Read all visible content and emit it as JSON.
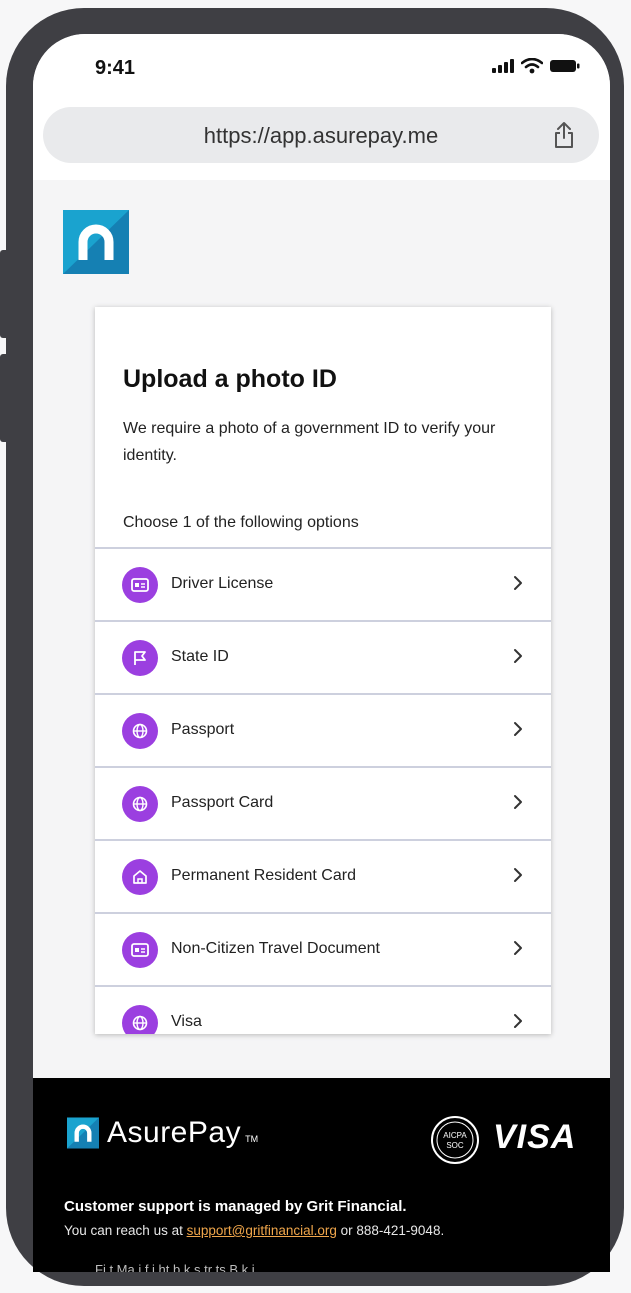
{
  "status_bar": {
    "time": "9:41"
  },
  "browser": {
    "url": "https://app.asurepay.me"
  },
  "card": {
    "title": "Upload a photo ID",
    "description": "We require a photo of a government ID to verify your identity.",
    "subtitle": "Choose 1 of the following options",
    "options": [
      {
        "label": "Driver License",
        "icon": "id-card-icon"
      },
      {
        "label": "State ID",
        "icon": "flag-icon"
      },
      {
        "label": "Passport",
        "icon": "globe-icon"
      },
      {
        "label": "Passport Card",
        "icon": "globe-icon"
      },
      {
        "label": "Permanent Resident Card",
        "icon": "home-icon"
      },
      {
        "label": "Non-Citizen Travel Document",
        "icon": "id-card-icon"
      },
      {
        "label": "Visa",
        "icon": "globe-icon"
      }
    ]
  },
  "footer": {
    "brand": "AsurePay",
    "brand_tm": "TM",
    "badge_top": "AICPA",
    "badge_bottom": "SOC",
    "visa": "VISA",
    "support_title": "Customer support is managed by Grit Financial.",
    "support_prefix": "You can reach us at ",
    "support_email": "support@gritfinancial.org",
    "support_suffix": " or 888-421-9048.",
    "disclaimer": "Fi     t   Ma i        f    i  ht    b   k  s       tr   ts  B    k i"
  },
  "colors": {
    "accent": "#9b3fe0",
    "logo_teal": "#1a9cc7",
    "link": "#f0a64b",
    "footer_bg": "#000000"
  }
}
